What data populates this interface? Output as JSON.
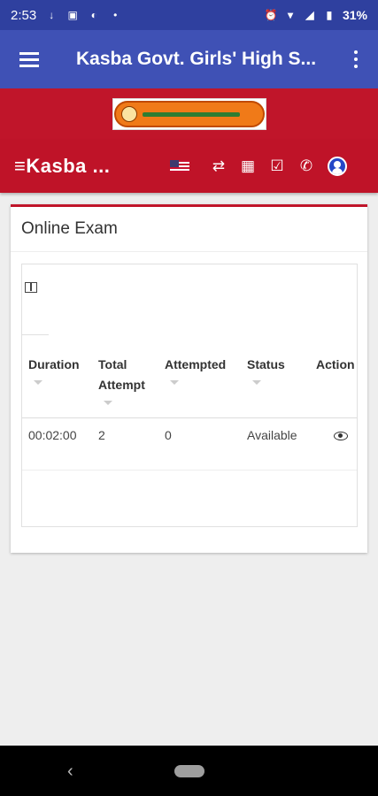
{
  "status_bar": {
    "time": "2:53",
    "battery": "31%"
  },
  "app_bar": {
    "title": "Kasba Govt. Girls' High S..."
  },
  "topbar": {
    "brand": "Kasba ..."
  },
  "card": {
    "title": "Online Exam",
    "columns": [
      "Duration",
      "Total Attempt",
      "Attempted",
      "Status",
      "Action"
    ],
    "rows": [
      {
        "duration": "00:02:00",
        "total_attempt": "2",
        "attempted": "0",
        "status": "Available",
        "action": "eye-icon"
      }
    ]
  },
  "colors": {
    "status_bar": "#2f409f",
    "app_bar": "#3f51b5",
    "banner": "#c0152a",
    "accent": "#c0152a"
  }
}
